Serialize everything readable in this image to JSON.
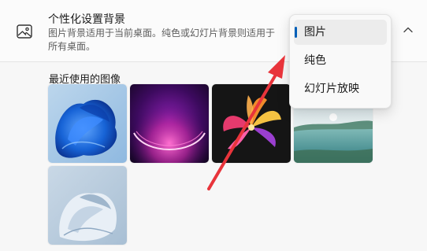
{
  "header": {
    "title": "个性化设置背景",
    "description": "图片背景适用于当前桌面。纯色或幻灯片背景则适用于所有桌面。",
    "icon": "image-icon",
    "collapse_icon": "chevron-up-icon"
  },
  "recent": {
    "label": "最近使用的图像",
    "images": [
      {
        "name": "blue-bloom-wallpaper"
      },
      {
        "name": "purple-glow-wallpaper"
      },
      {
        "name": "colorful-flower-wallpaper"
      },
      {
        "name": "lake-sunrise-wallpaper"
      },
      {
        "name": "white-bloom-wallpaper"
      }
    ]
  },
  "dropdown": {
    "options": [
      "图片",
      "纯色",
      "幻灯片放映"
    ],
    "selected": "图片",
    "accent": "#005fb8"
  },
  "annotation": {
    "color": "#e8343b"
  }
}
